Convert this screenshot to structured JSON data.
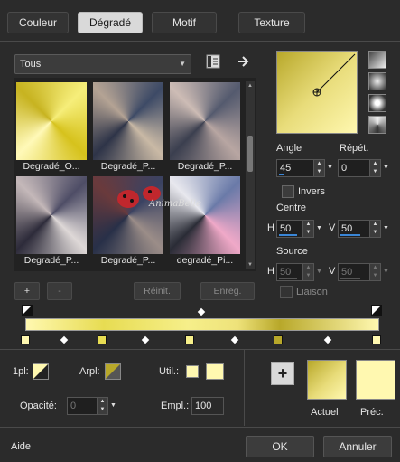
{
  "tabs": [
    "Couleur",
    "Dégradé",
    "Motif",
    "Texture"
  ],
  "category": {
    "selected": "Tous"
  },
  "presets": [
    {
      "label": "Degradé_O..."
    },
    {
      "label": "Degradé_P..."
    },
    {
      "label": "Degradé_P..."
    },
    {
      "label": "Degradé_P..."
    },
    {
      "label": "Degradé_P..."
    },
    {
      "label": "degradé_Pi..."
    }
  ],
  "watermark": "AnimaBelle",
  "buttons": {
    "add": "+",
    "remove": "-",
    "reset": "Réinit.",
    "save": "Enreg.",
    "ok": "OK",
    "cancel": "Annuler",
    "help": "Aide",
    "add_color": "+"
  },
  "angle": {
    "label": "Angle",
    "value": "45"
  },
  "repeat": {
    "label": "Répét.",
    "value": "0"
  },
  "invert": {
    "label": "Invers"
  },
  "center": {
    "label": "Centre",
    "h_label": "H",
    "h": "50",
    "v_label": "V",
    "v": "50"
  },
  "source": {
    "label": "Source",
    "h_label": "H",
    "h": "50",
    "v_label": "V",
    "v": "50"
  },
  "link": {
    "label": "Liaison"
  },
  "bottom": {
    "first_plane_label": "1pl:",
    "background_label": "Arpl:",
    "util_label": "Util.:",
    "opacity_label": "Opacité:",
    "opacity_value": "0",
    "location_label": "Empl.:",
    "location_value": "100",
    "current_label": "Actuel",
    "previous_label": "Préc."
  },
  "colors": {
    "accent": "#3a86d6",
    "gold": "#b8a82a",
    "pale": "#fff8b0"
  }
}
